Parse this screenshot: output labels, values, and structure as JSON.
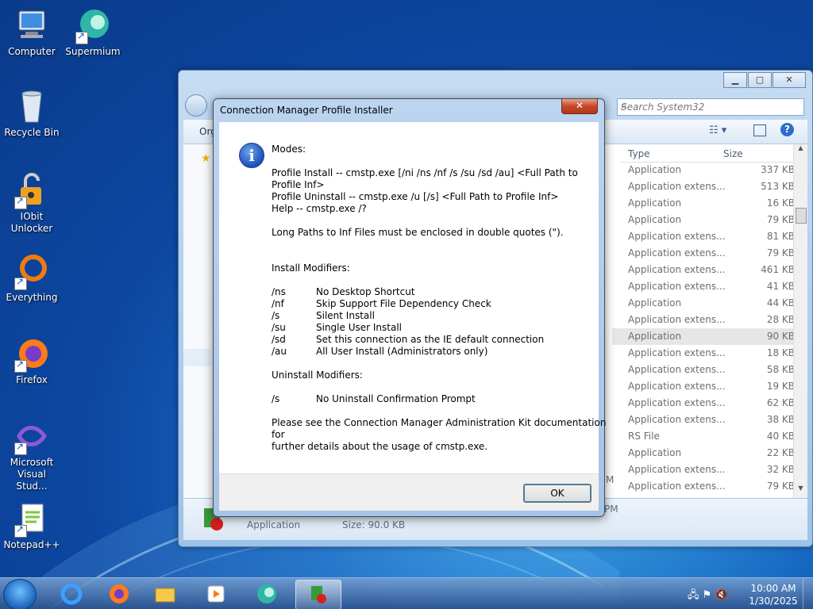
{
  "desktop": {
    "icons": [
      {
        "label": "Computer",
        "icon": "computer-icon"
      },
      {
        "label": "Supermium",
        "icon": "supermium-icon"
      },
      {
        "label": "Recycle Bin",
        "icon": "recycle-bin-icon"
      },
      {
        "label": "IObit Unlocker",
        "icon": "iobit-unlocker-icon"
      },
      {
        "label": "Everything",
        "icon": "everything-icon"
      },
      {
        "label": "Firefox",
        "icon": "firefox-icon"
      },
      {
        "label": "Microsoft Visual Stud...",
        "icon": "visual-studio-icon"
      },
      {
        "label": "Notepad++",
        "icon": "notepadpp-icon"
      }
    ]
  },
  "explorer": {
    "search_placeholder": "Search System32",
    "toolbar": {
      "organize_partial": "Org"
    },
    "columns": {
      "type": "Type",
      "size": "Size"
    },
    "files": [
      {
        "type": "Application",
        "size": "337 KB"
      },
      {
        "type": "Application extens...",
        "size": "513 KB"
      },
      {
        "type": "Application",
        "size": "16 KB"
      },
      {
        "type": "Application",
        "size": "79 KB"
      },
      {
        "type": "Application extens...",
        "size": "81 KB"
      },
      {
        "type": "Application extens...",
        "size": "79 KB"
      },
      {
        "type": "Application extens...",
        "size": "461 KB"
      },
      {
        "type": "Application extens...",
        "size": "41 KB"
      },
      {
        "type": "Application",
        "size": "44 KB"
      },
      {
        "type": "Application extens...",
        "size": "28 KB"
      },
      {
        "type": "Application",
        "size": "90 KB"
      },
      {
        "type": "Application extens...",
        "size": "18 KB"
      },
      {
        "type": "Application extens...",
        "size": "58 KB"
      },
      {
        "type": "Application extens...",
        "size": "19 KB"
      },
      {
        "type": "Application extens...",
        "size": "62 KB"
      },
      {
        "type": "Application extens...",
        "size": "38 KB"
      },
      {
        "type": "RS File",
        "size": "40 KB"
      },
      {
        "type": "Application",
        "size": "22 KB"
      },
      {
        "type": "Application extens...",
        "size": "32 KB"
      },
      {
        "type": "Application extens...",
        "size": "79 KB"
      }
    ],
    "selected_index": 10,
    "details": {
      "type": "Application",
      "size": "Size: 90.0 KB",
      "time_partial": "PM"
    },
    "row_leak_m": "M"
  },
  "dialog": {
    "title": "Connection Manager Profile Installer",
    "close": "✕",
    "info_glyph": "i",
    "lines": [
      "Modes:",
      "Profile Install -- cmstp.exe [/ni /ns /nf /s /su /sd /au] <Full Path to",
      "Profile Inf>",
      "Profile Uninstall -- cmstp.exe /u [/s] <Full Path to Profile Inf>",
      "Help -- cmstp.exe /?",
      "Long Paths to Inf Files must be enclosed in double quotes (\").",
      "Install Modifiers:"
    ],
    "install_modifiers": [
      {
        "key": "/ns",
        "desc": "No Desktop Shortcut"
      },
      {
        "key": "/nf",
        "desc": "Skip Support File Dependency Check"
      },
      {
        "key": "/s",
        "desc": "Silent Install"
      },
      {
        "key": "/su",
        "desc": "Single User Install"
      },
      {
        "key": "/sd",
        "desc": "Set this connection as the IE default connection"
      },
      {
        "key": "/au",
        "desc": "All User Install (Administrators only)"
      }
    ],
    "uninstall_heading": "Uninstall Modifiers:",
    "uninstall_modifiers": [
      {
        "key": "/s",
        "desc": "No Uninstall Confirmation Prompt"
      }
    ],
    "footer_lines": [
      "Please see the Connection Manager Administration Kit documentation",
      "for",
      "further details about the usage of cmstp.exe."
    ],
    "ok": "OK"
  },
  "taskbar": {
    "time": "10:00 AM",
    "date": "1/30/2025"
  }
}
